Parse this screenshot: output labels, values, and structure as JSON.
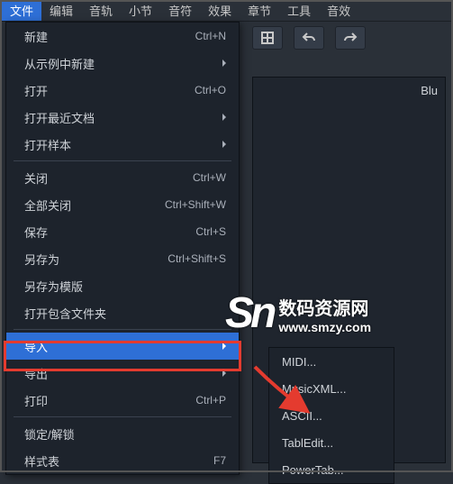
{
  "menubar": {
    "items": [
      "文件",
      "编辑",
      "音轨",
      "小节",
      "音符",
      "效果",
      "章节",
      "工具",
      "音效"
    ]
  },
  "panel": {
    "title": "Blu"
  },
  "menu": {
    "items": [
      {
        "type": "item",
        "label": "新建",
        "shortcut": "Ctrl+N",
        "submenu": false
      },
      {
        "type": "item",
        "label": "从示例中新建",
        "shortcut": "",
        "submenu": true
      },
      {
        "type": "item",
        "label": "打开",
        "shortcut": "Ctrl+O",
        "submenu": false
      },
      {
        "type": "item",
        "label": "打开最近文档",
        "shortcut": "",
        "submenu": true
      },
      {
        "type": "item",
        "label": "打开样本",
        "shortcut": "",
        "submenu": true
      },
      {
        "type": "divider"
      },
      {
        "type": "item",
        "label": "关闭",
        "shortcut": "Ctrl+W",
        "submenu": false
      },
      {
        "type": "item",
        "label": "全部关闭",
        "shortcut": "Ctrl+Shift+W",
        "submenu": false
      },
      {
        "type": "item",
        "label": "保存",
        "shortcut": "Ctrl+S",
        "submenu": false
      },
      {
        "type": "item",
        "label": "另存为",
        "shortcut": "Ctrl+Shift+S",
        "submenu": false
      },
      {
        "type": "item",
        "label": "另存为模版",
        "shortcut": "",
        "submenu": false
      },
      {
        "type": "item",
        "label": "打开包含文件夹",
        "shortcut": "",
        "submenu": false
      },
      {
        "type": "divider"
      },
      {
        "type": "item",
        "label": "导入",
        "shortcut": "",
        "submenu": true,
        "highlighted": true
      },
      {
        "type": "item",
        "label": "导出",
        "shortcut": "",
        "submenu": true
      },
      {
        "type": "item",
        "label": "打印",
        "shortcut": "Ctrl+P",
        "submenu": false
      },
      {
        "type": "divider"
      },
      {
        "type": "item",
        "label": "锁定/解锁",
        "shortcut": "",
        "submenu": false
      },
      {
        "type": "item",
        "label": "样式表",
        "shortcut": "F7",
        "submenu": false
      }
    ]
  },
  "submenu": {
    "items": [
      "MIDI...",
      "MusicXML...",
      "ASCII...",
      "TablEdit...",
      "PowerTab..."
    ]
  },
  "watermark": {
    "logo": "Sn",
    "title": "数码资源网",
    "url": "www.smzy.com"
  }
}
